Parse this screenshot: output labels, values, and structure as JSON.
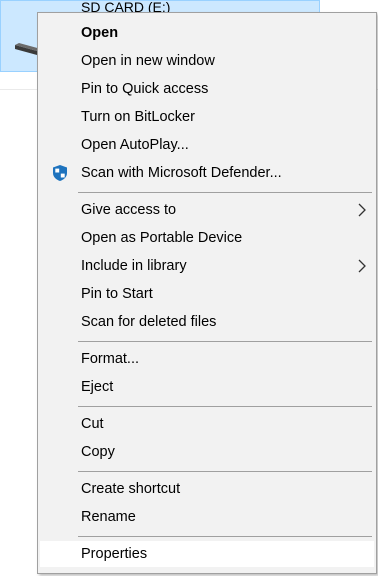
{
  "background": {
    "drive_label": "SD CARD (E:)"
  },
  "context_menu": {
    "groups": [
      {
        "items": [
          {
            "label": "Open",
            "bold": true
          },
          {
            "label": "Open in new window"
          },
          {
            "label": "Pin to Quick access"
          },
          {
            "label": "Turn on BitLocker"
          },
          {
            "label": "Open AutoPlay..."
          },
          {
            "label": "Scan with Microsoft Defender...",
            "icon": "defender-shield-icon"
          }
        ]
      },
      {
        "items": [
          {
            "label": "Give access to",
            "submenu": true
          },
          {
            "label": "Open as Portable Device"
          },
          {
            "label": "Include in library",
            "submenu": true
          },
          {
            "label": "Pin to Start"
          },
          {
            "label": "Scan for deleted files"
          }
        ]
      },
      {
        "items": [
          {
            "label": "Format..."
          },
          {
            "label": "Eject"
          }
        ]
      },
      {
        "items": [
          {
            "label": "Cut"
          },
          {
            "label": "Copy"
          }
        ]
      },
      {
        "items": [
          {
            "label": "Create shortcut"
          },
          {
            "label": "Rename"
          }
        ]
      },
      {
        "items": [
          {
            "label": "Properties",
            "hovered": true
          }
        ]
      }
    ]
  },
  "colors": {
    "menu_background": "#f2f2f2",
    "separator": "#a0a0a0",
    "selection_fill": "#cce8ff",
    "defender_blue": "#1e73be"
  }
}
